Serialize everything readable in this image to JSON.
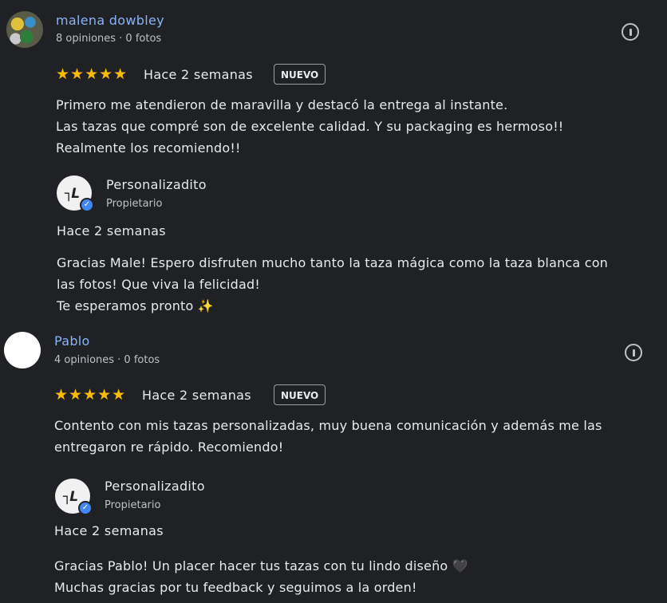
{
  "reviews": [
    {
      "author": "malena dowbley",
      "meta": "8 opiniones · 0 fotos",
      "stars": "★★★★★",
      "rating": 5,
      "when": "Hace 2 semanas",
      "badge": "NUEVO",
      "text": "Primero me atendieron de maravilla y destacó la entrega al instante.\nLas tazas que compré son de excelente calidad. Y su packaging es hermoso!!\nRealmente los recomiendo!!",
      "reply": {
        "owner": "Personalizadito",
        "role": "Propietario",
        "when": "Hace 2 semanas",
        "text": "Gracias Male! Espero disfruten mucho tanto la taza mágica como la taza blanca con\nlas fotos! Que viva la felicidad!\nTe esperamos pronto ✨"
      }
    },
    {
      "author": "Pablo",
      "meta": "4 opiniones · 0 fotos",
      "stars": "★★★★★",
      "rating": 5,
      "when": "Hace 2 semanas",
      "badge": "NUEVO",
      "text": "Contento con mis tazas personalizadas, muy buena comunicación y además me las\nentregaron re rápido. Recomiendo!",
      "reply": {
        "owner": "Personalizadito",
        "role": "Propietario",
        "when": "Hace 2 semanas",
        "text": "Gracias Pablo! Un placer hacer tus tazas con tu lindo diseño 🖤\nMuchas gracias por tu feedback y seguimos a la orden!"
      }
    }
  ],
  "icons": {
    "flag": "report-flag-icon",
    "verified": "verified-check-icon",
    "star_color": "#fbbc04",
    "name_color": "#8ab4f8"
  }
}
